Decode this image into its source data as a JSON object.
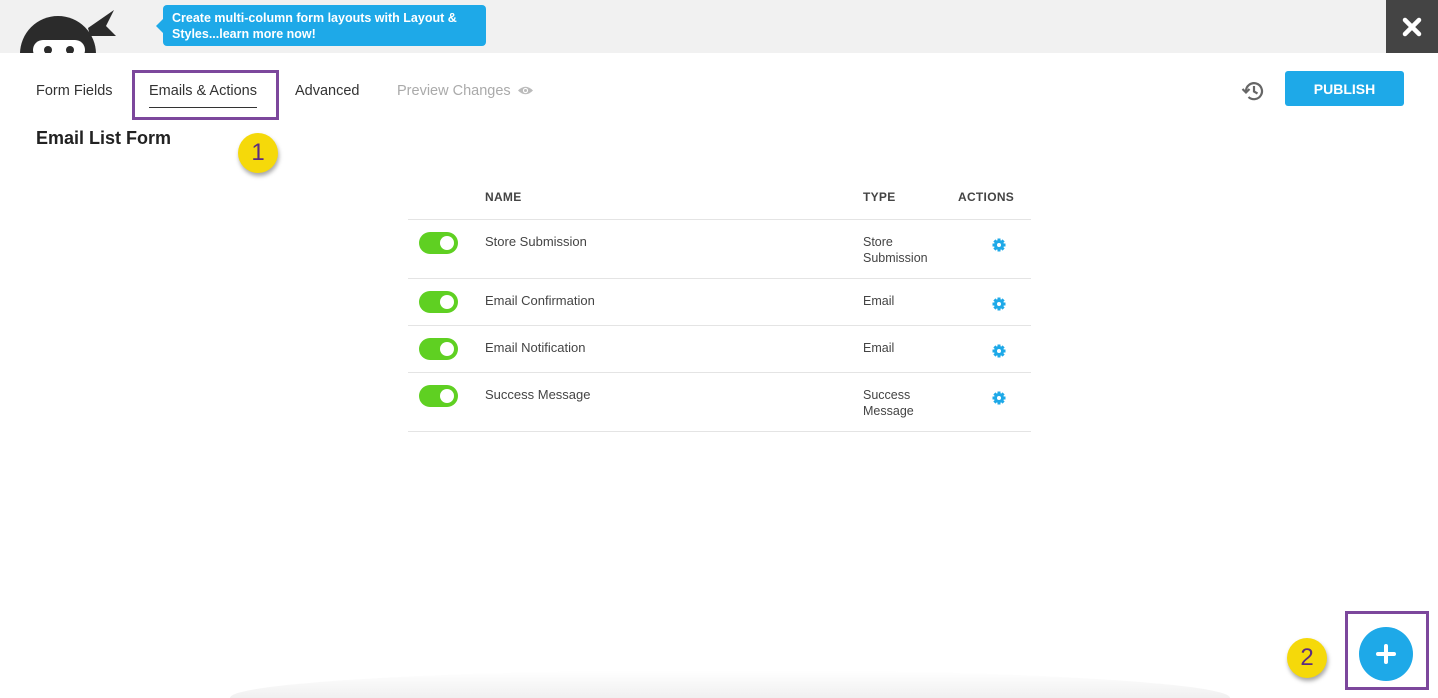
{
  "header": {
    "tip_text": "Create multi-column form layouts with Layout & Styles...learn more now!",
    "close_icon": "close-icon"
  },
  "tabs": [
    {
      "label": "Form Fields"
    },
    {
      "label": "Emails & Actions",
      "active": true
    },
    {
      "label": "Advanced"
    },
    {
      "label": "Preview Changes",
      "disabled": true
    }
  ],
  "publish_label": "PUBLISH",
  "page_title": "Email List Form",
  "annotations": {
    "one": "1",
    "two": "2"
  },
  "table": {
    "headers": {
      "name": "NAME",
      "type": "TYPE",
      "actions": "ACTIONS"
    },
    "rows": [
      {
        "enabled": true,
        "name": "Store Submission",
        "type_line1": "Store",
        "type_line2": "Submission"
      },
      {
        "enabled": true,
        "name": "Email Confirmation",
        "type_line1": "Email",
        "type_line2": ""
      },
      {
        "enabled": true,
        "name": "Email Notification",
        "type_line1": "Email",
        "type_line2": ""
      },
      {
        "enabled": true,
        "name": "Success Message",
        "type_line1": "Success",
        "type_line2": "Message"
      }
    ]
  },
  "colors": {
    "accent": "#1ea9e8",
    "toggle_on": "#5fd022",
    "highlight": "#7c479c",
    "badge": "#f5d90a"
  }
}
